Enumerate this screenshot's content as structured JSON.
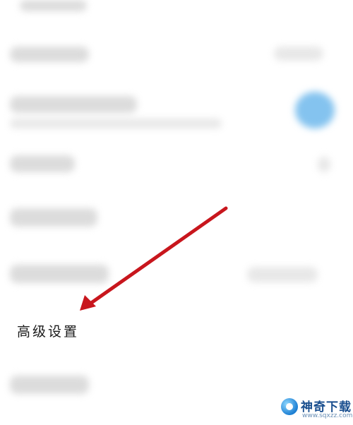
{
  "settings": {
    "focused_item_label": "高级设置"
  },
  "watermark": {
    "brand": "神奇下载",
    "url": "www.sqxzz.com"
  },
  "colors": {
    "arrow": "#c8161d",
    "toggle_on": "#6fb8ec",
    "brand": "#1a4f8f"
  },
  "icons": [
    "arrow-pointer",
    "toggle-switch",
    "site-logo-icon"
  ]
}
